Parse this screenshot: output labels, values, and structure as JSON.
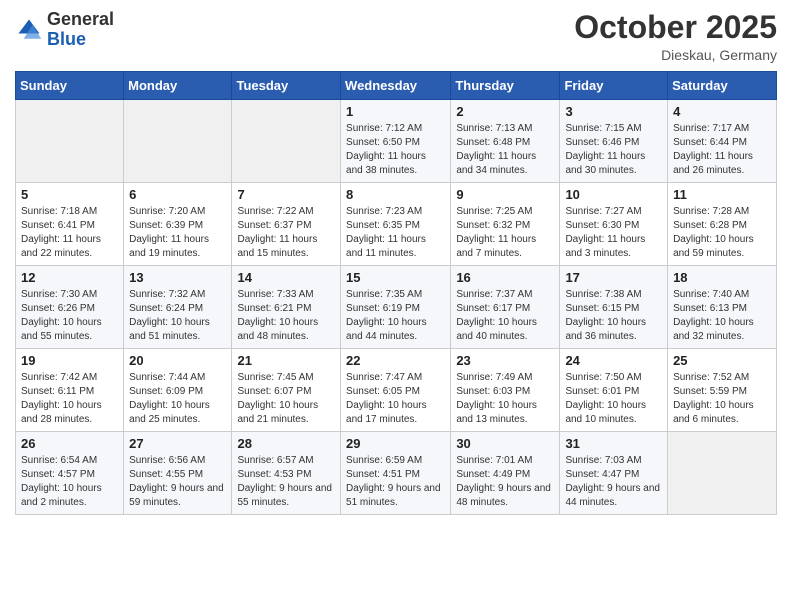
{
  "header": {
    "logo_general": "General",
    "logo_blue": "Blue",
    "month_title": "October 2025",
    "location": "Dieskau, Germany"
  },
  "days_of_week": [
    "Sunday",
    "Monday",
    "Tuesday",
    "Wednesday",
    "Thursday",
    "Friday",
    "Saturday"
  ],
  "weeks": [
    [
      {
        "day": "",
        "info": ""
      },
      {
        "day": "",
        "info": ""
      },
      {
        "day": "",
        "info": ""
      },
      {
        "day": "1",
        "info": "Sunrise: 7:12 AM\nSunset: 6:50 PM\nDaylight: 11 hours and 38 minutes."
      },
      {
        "day": "2",
        "info": "Sunrise: 7:13 AM\nSunset: 6:48 PM\nDaylight: 11 hours and 34 minutes."
      },
      {
        "day": "3",
        "info": "Sunrise: 7:15 AM\nSunset: 6:46 PM\nDaylight: 11 hours and 30 minutes."
      },
      {
        "day": "4",
        "info": "Sunrise: 7:17 AM\nSunset: 6:44 PM\nDaylight: 11 hours and 26 minutes."
      }
    ],
    [
      {
        "day": "5",
        "info": "Sunrise: 7:18 AM\nSunset: 6:41 PM\nDaylight: 11 hours and 22 minutes."
      },
      {
        "day": "6",
        "info": "Sunrise: 7:20 AM\nSunset: 6:39 PM\nDaylight: 11 hours and 19 minutes."
      },
      {
        "day": "7",
        "info": "Sunrise: 7:22 AM\nSunset: 6:37 PM\nDaylight: 11 hours and 15 minutes."
      },
      {
        "day": "8",
        "info": "Sunrise: 7:23 AM\nSunset: 6:35 PM\nDaylight: 11 hours and 11 minutes."
      },
      {
        "day": "9",
        "info": "Sunrise: 7:25 AM\nSunset: 6:32 PM\nDaylight: 11 hours and 7 minutes."
      },
      {
        "day": "10",
        "info": "Sunrise: 7:27 AM\nSunset: 6:30 PM\nDaylight: 11 hours and 3 minutes."
      },
      {
        "day": "11",
        "info": "Sunrise: 7:28 AM\nSunset: 6:28 PM\nDaylight: 10 hours and 59 minutes."
      }
    ],
    [
      {
        "day": "12",
        "info": "Sunrise: 7:30 AM\nSunset: 6:26 PM\nDaylight: 10 hours and 55 minutes."
      },
      {
        "day": "13",
        "info": "Sunrise: 7:32 AM\nSunset: 6:24 PM\nDaylight: 10 hours and 51 minutes."
      },
      {
        "day": "14",
        "info": "Sunrise: 7:33 AM\nSunset: 6:21 PM\nDaylight: 10 hours and 48 minutes."
      },
      {
        "day": "15",
        "info": "Sunrise: 7:35 AM\nSunset: 6:19 PM\nDaylight: 10 hours and 44 minutes."
      },
      {
        "day": "16",
        "info": "Sunrise: 7:37 AM\nSunset: 6:17 PM\nDaylight: 10 hours and 40 minutes."
      },
      {
        "day": "17",
        "info": "Sunrise: 7:38 AM\nSunset: 6:15 PM\nDaylight: 10 hours and 36 minutes."
      },
      {
        "day": "18",
        "info": "Sunrise: 7:40 AM\nSunset: 6:13 PM\nDaylight: 10 hours and 32 minutes."
      }
    ],
    [
      {
        "day": "19",
        "info": "Sunrise: 7:42 AM\nSunset: 6:11 PM\nDaylight: 10 hours and 28 minutes."
      },
      {
        "day": "20",
        "info": "Sunrise: 7:44 AM\nSunset: 6:09 PM\nDaylight: 10 hours and 25 minutes."
      },
      {
        "day": "21",
        "info": "Sunrise: 7:45 AM\nSunset: 6:07 PM\nDaylight: 10 hours and 21 minutes."
      },
      {
        "day": "22",
        "info": "Sunrise: 7:47 AM\nSunset: 6:05 PM\nDaylight: 10 hours and 17 minutes."
      },
      {
        "day": "23",
        "info": "Sunrise: 7:49 AM\nSunset: 6:03 PM\nDaylight: 10 hours and 13 minutes."
      },
      {
        "day": "24",
        "info": "Sunrise: 7:50 AM\nSunset: 6:01 PM\nDaylight: 10 hours and 10 minutes."
      },
      {
        "day": "25",
        "info": "Sunrise: 7:52 AM\nSunset: 5:59 PM\nDaylight: 10 hours and 6 minutes."
      }
    ],
    [
      {
        "day": "26",
        "info": "Sunrise: 6:54 AM\nSunset: 4:57 PM\nDaylight: 10 hours and 2 minutes."
      },
      {
        "day": "27",
        "info": "Sunrise: 6:56 AM\nSunset: 4:55 PM\nDaylight: 9 hours and 59 minutes."
      },
      {
        "day": "28",
        "info": "Sunrise: 6:57 AM\nSunset: 4:53 PM\nDaylight: 9 hours and 55 minutes."
      },
      {
        "day": "29",
        "info": "Sunrise: 6:59 AM\nSunset: 4:51 PM\nDaylight: 9 hours and 51 minutes."
      },
      {
        "day": "30",
        "info": "Sunrise: 7:01 AM\nSunset: 4:49 PM\nDaylight: 9 hours and 48 minutes."
      },
      {
        "day": "31",
        "info": "Sunrise: 7:03 AM\nSunset: 4:47 PM\nDaylight: 9 hours and 44 minutes."
      },
      {
        "day": "",
        "info": ""
      }
    ]
  ]
}
